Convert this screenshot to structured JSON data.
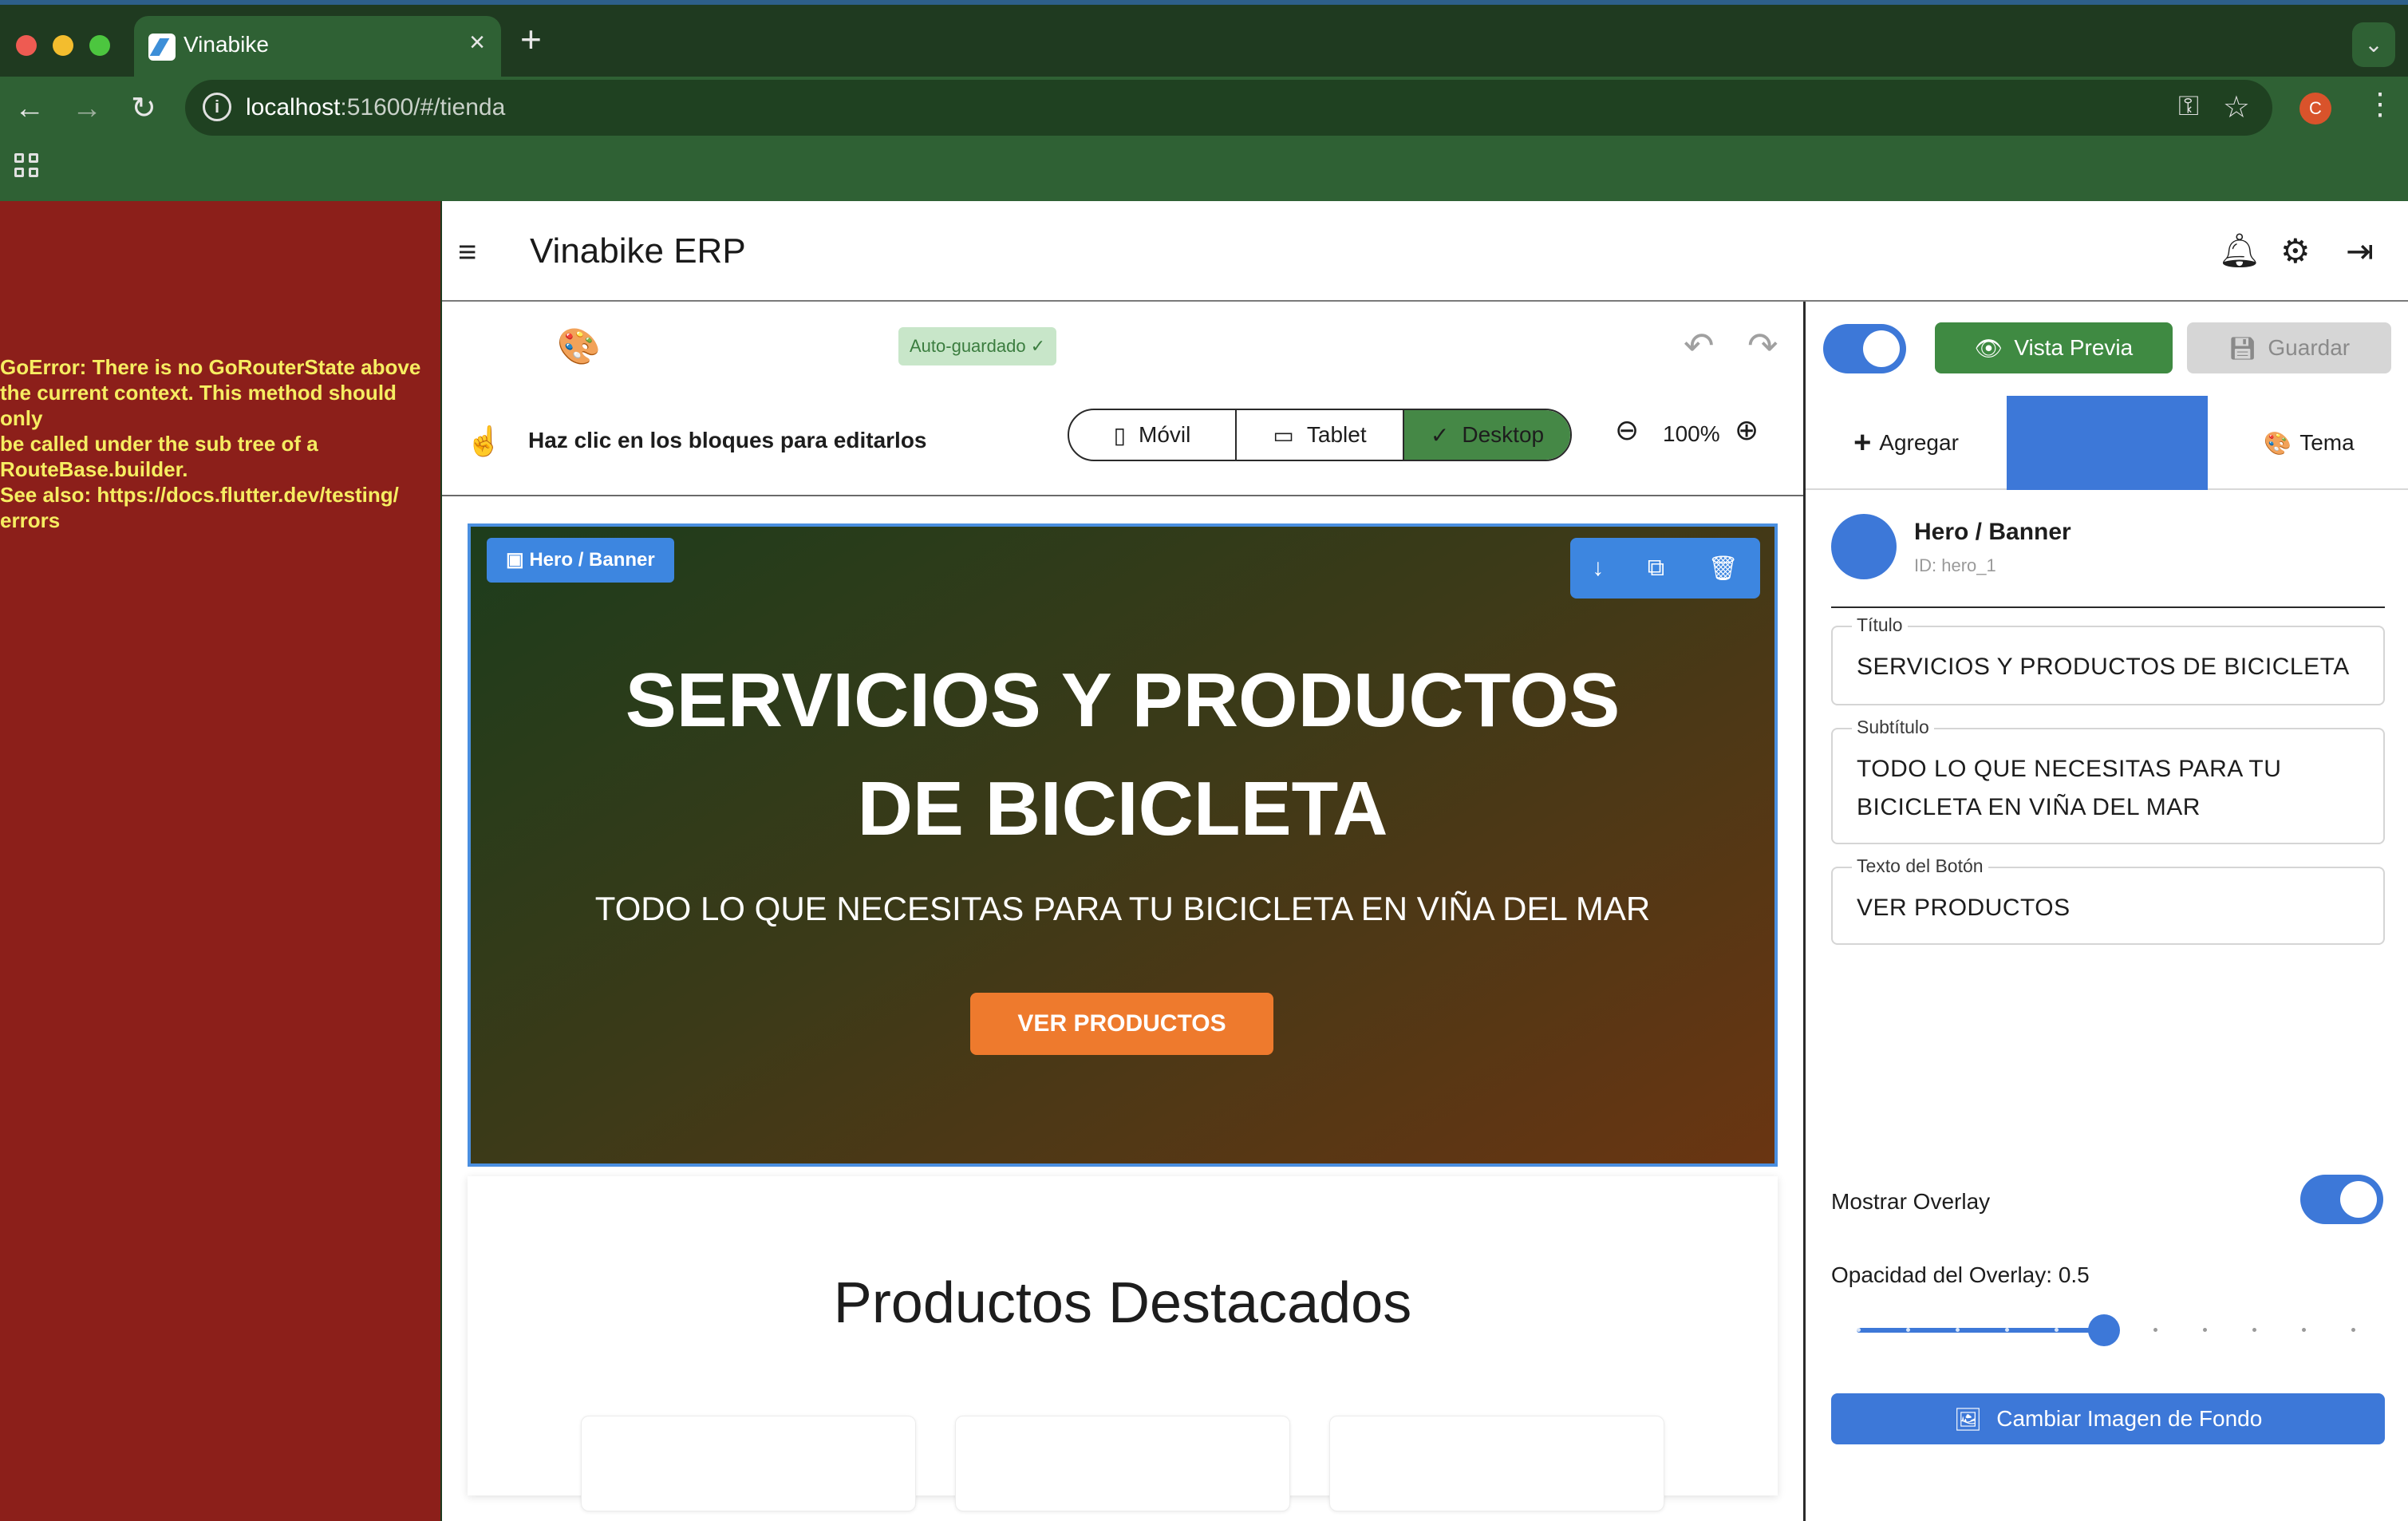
{
  "browser": {
    "tab_title": "Vinabike",
    "url_host": "localhost",
    "url_path": ":51600/#/tienda",
    "profile_initial": "C"
  },
  "error": {
    "message": "GoError: There is no GoRouterState above\nthe current context. This method should only\nbe called under the sub tree of a\nRouteBase.builder.\nSee also: https://docs.flutter.dev/testing/\nerrors"
  },
  "app": {
    "title": "Vinabike ERP"
  },
  "toolbar": {
    "autosave_label": "Auto-guardado ✓",
    "hint": "Haz clic en los bloques para editarlos",
    "devices": [
      {
        "label": "Móvil",
        "icon": "phone-icon",
        "active": false
      },
      {
        "label": "Tablet",
        "icon": "tablet-icon",
        "active": false
      },
      {
        "label": "Desktop",
        "icon": "check-icon",
        "active": true
      }
    ],
    "zoom": "100%"
  },
  "hero": {
    "chip_label": "Hero / Banner",
    "title": "SERVICIOS Y PRODUCTOS DE BICICLETA",
    "subtitle": "TODO LO QUE NECESITAS PARA TU BICICLETA EN VIÑA DEL MAR",
    "button_label": "VER PRODUCTOS"
  },
  "featured": {
    "title": "Productos Destacados"
  },
  "panel": {
    "preview_label": "Vista Previa",
    "save_label": "Guardar",
    "tabs": [
      {
        "label": "Agregar",
        "icon": "plus-icon"
      },
      {
        "label": "",
        "icon": ""
      },
      {
        "label": "Tema",
        "icon": "palette-icon"
      }
    ],
    "selected_name": "Hero / Banner",
    "selected_id": "ID: hero_1",
    "fields": {
      "title_label": "Título",
      "title_value": "SERVICIOS Y PRODUCTOS DE BICICLETA",
      "subtitle_label": "Subtítulo",
      "subtitle_value": "TODO LO QUE NECESITAS PARA TU BICICLETA EN VIÑA DEL MAR",
      "button_label": "Texto del Botón",
      "button_value": "VER PRODUCTOS"
    },
    "overlay_label": "Mostrar Overlay",
    "overlay_on": true,
    "opacity_label": "Opacidad del Overlay: 0.5",
    "opacity_value": 0.5,
    "change_bg_label": "Cambiar Imagen de Fondo"
  },
  "colors": {
    "accent_blue": "#3d78d8",
    "green": "#3f8a42",
    "orange": "#ee7a2d",
    "error_bg": "#8c1f1a",
    "error_text": "#f6ed61"
  }
}
